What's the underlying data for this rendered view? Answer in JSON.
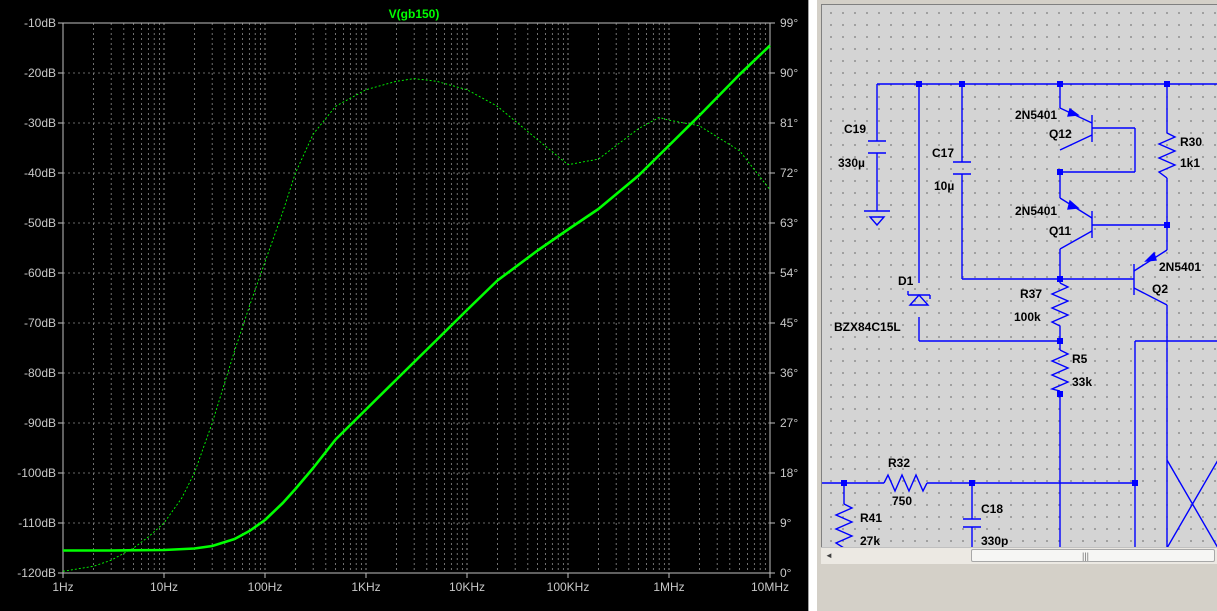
{
  "plot": {
    "trace_label": "V(gb150)",
    "trace_color": "#00ff00",
    "background_color": "#000000",
    "grid_color": "#8c8c8c"
  },
  "chart_data": {
    "type": "line",
    "title": "V(gb150)",
    "x_scale": "log",
    "xlim": [
      1,
      10000000
    ],
    "x_tick_values": [
      1,
      10,
      100,
      1000,
      10000,
      100000,
      1000000,
      10000000
    ],
    "x_tick_labels": [
      "1Hz",
      "10Hz",
      "100Hz",
      "1KHz",
      "10KHz",
      "100KHz",
      "1MHz",
      "10MHz"
    ],
    "y_left_lim": [
      -120,
      -10
    ],
    "y_left_tick_labels": [
      "-10dB",
      "-20dB",
      "-30dB",
      "-40dB",
      "-50dB",
      "-60dB",
      "-70dB",
      "-80dB",
      "-90dB",
      "-100dB",
      "-110dB",
      "-120dB"
    ],
    "y_right_lim": [
      0,
      99
    ],
    "y_right_tick_labels": [
      "99°",
      "90°",
      "81°",
      "72°",
      "63°",
      "54°",
      "45°",
      "36°",
      "27°",
      "18°",
      "9°",
      "0°"
    ],
    "grid": true,
    "series": [
      {
        "axis": "left",
        "style": "solid",
        "x": [
          1,
          3,
          10,
          20,
          30,
          50,
          70,
          100,
          150,
          200,
          300,
          500,
          1000,
          2000,
          5000,
          10000,
          20000,
          50000,
          100000,
          200000,
          500000,
          1000000,
          2000000,
          5000000,
          10000000
        ],
        "y": [
          -115.5,
          -115.5,
          -115.4,
          -115.1,
          -114.6,
          -113.2,
          -111.6,
          -109.4,
          -106.0,
          -103.2,
          -99.0,
          -93.3,
          -87.3,
          -81.3,
          -73.4,
          -67.4,
          -61.5,
          -55.5,
          -51.3,
          -47.2,
          -40.5,
          -34.5,
          -28.5,
          -20.3,
          -14.5
        ]
      },
      {
        "axis": "right",
        "style": "dashed",
        "x": [
          1,
          2,
          3,
          5,
          7,
          10,
          15,
          20,
          30,
          50,
          70,
          100,
          150,
          200,
          300,
          500,
          1000,
          2000,
          3000,
          5000,
          10000,
          20000,
          50000,
          100000,
          200000,
          500000,
          800000,
          1000000,
          2000000,
          5000000,
          10000000
        ],
        "y": [
          0.3,
          1.2,
          2.3,
          4.5,
          6.5,
          9.0,
          13.5,
          18.0,
          27.0,
          40.0,
          48.0,
          56.0,
          65.0,
          72.0,
          79.0,
          84.0,
          87.0,
          88.5,
          89.0,
          88.5,
          87.0,
          84.0,
          78.0,
          73.5,
          74.5,
          80.0,
          82.0,
          81.5,
          80.5,
          76.0,
          69.0
        ]
      }
    ]
  },
  "schematic": {
    "components": {
      "c19": {
        "name": "C19",
        "value": "330µ"
      },
      "c17": {
        "name": "C17",
        "value": "10µ"
      },
      "q12": {
        "name": "Q12",
        "model": "2N5401"
      },
      "q11": {
        "name": "Q11",
        "model": "2N5401"
      },
      "q2": {
        "name": "Q2",
        "model": "2N5401"
      },
      "r30": {
        "name": "R30",
        "value": "1k1"
      },
      "d1": {
        "name": "D1",
        "model": "BZX84C15L"
      },
      "r37": {
        "name": "R37",
        "value": "100k"
      },
      "r5": {
        "name": "R5",
        "value": "33k"
      },
      "r32": {
        "name": "R32",
        "value": "750"
      },
      "c18": {
        "name": "C18",
        "value": "330p"
      },
      "r41": {
        "name": "R41",
        "value": "27k"
      }
    },
    "wire_color": "#0000ff",
    "scrollbar": {
      "left_arrow": "◄",
      "grip": "|||"
    }
  }
}
